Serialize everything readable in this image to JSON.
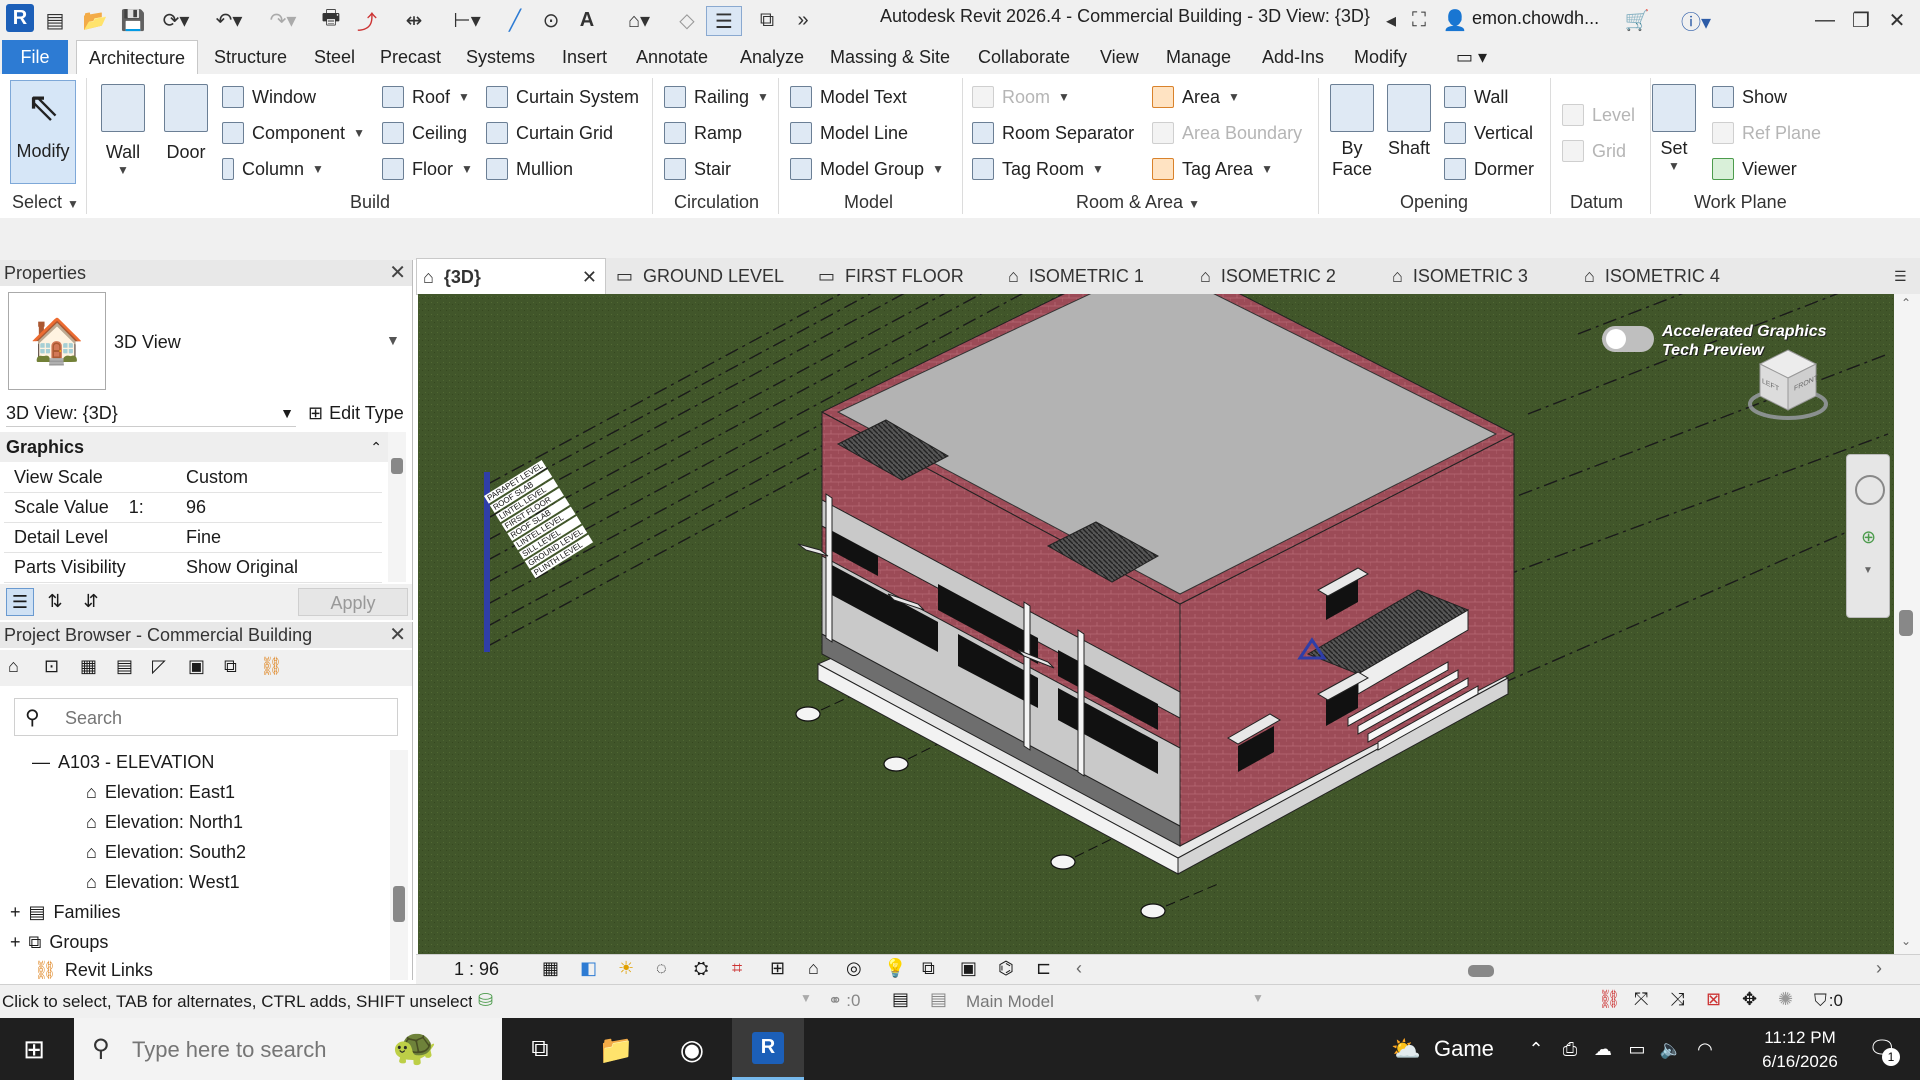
{
  "window": {
    "title": "Autodesk Revit 2026.4 - Commercial Building - 3D View: {3D}",
    "user": "emon.chowdh...",
    "logo_letter": "R"
  },
  "menu_tabs": [
    "File",
    "Architecture",
    "Structure",
    "Steel",
    "Precast",
    "Systems",
    "Insert",
    "Annotate",
    "Analyze",
    "Massing & Site",
    "Collaborate",
    "View",
    "Manage",
    "Add-Ins",
    "Modify"
  ],
  "ribbon": {
    "select": {
      "modify": "Modify",
      "panel": "Select"
    },
    "build": {
      "panel": "Build",
      "wall": "Wall",
      "door": "Door",
      "window": "Window",
      "component": "Component",
      "column": "Column",
      "roof": "Roof",
      "ceiling": "Ceiling",
      "floor": "Floor",
      "curtain_system": "Curtain  System",
      "curtain_grid": "Curtain  Grid",
      "mullion": "Mullion"
    },
    "circulation": {
      "panel": "Circulation",
      "railing": "Railing",
      "ramp": "Ramp",
      "stair": "Stair"
    },
    "model": {
      "panel": "Model",
      "model_text": "Model  Text",
      "model_line": "Model  Line",
      "model_group": "Model  Group"
    },
    "room_area": {
      "panel": "Room & Area",
      "room": "Room",
      "room_separator": "Room  Separator",
      "tag_room": "Tag  Room",
      "area": "Area",
      "area_boundary": "Area  Boundary",
      "tag_area": "Tag  Area"
    },
    "opening": {
      "panel": "Opening",
      "by_face_1": "By",
      "by_face_2": "Face",
      "shaft": "Shaft",
      "wall": "Wall",
      "vertical": "Vertical",
      "dormer": "Dormer"
    },
    "datum": {
      "panel": "Datum",
      "level": "Level",
      "grid": "Grid"
    },
    "work_plane": {
      "panel": "Work Plane",
      "set": "Set",
      "show": "Show",
      "ref_plane": "Ref  Plane",
      "viewer": "Viewer"
    }
  },
  "properties": {
    "title": "Properties",
    "type_name": "3D View",
    "instance": "3D View: {3D}",
    "edit_type": "Edit Type",
    "section": "Graphics",
    "rows": [
      {
        "key": "View Scale",
        "value": "Custom"
      },
      {
        "key": "Scale Value    1:",
        "value": "96"
      },
      {
        "key": "Detail Level",
        "value": "Fine"
      },
      {
        "key": "Parts Visibility",
        "value": "Show Original"
      }
    ],
    "apply": "Apply"
  },
  "browser": {
    "title": "Project Browser - Commercial Building",
    "search_placeholder": "Search",
    "group": "A103 - ELEVATION",
    "elevations": [
      "Elevation: East1",
      "Elevation: North1",
      "Elevation: South2",
      "Elevation: West1"
    ],
    "families": "Families",
    "groups": "Groups",
    "revit_links": "Revit Links"
  },
  "view_tabs": [
    "{3D}",
    "GROUND LEVEL",
    "FIRST FLOOR",
    "ISOMETRIC 1",
    "ISOMETRIC 2",
    "ISOMETRIC 3",
    "ISOMETRIC 4"
  ],
  "viewport": {
    "graphics_toggle_1": "Accelerated Graphics",
    "graphics_toggle_2": "Tech Preview",
    "level_labels": [
      "PARAPET LEVEL",
      "ROOF SLAB",
      "LINTEL LEVEL",
      "FIRST FLOOR",
      "ROOF SLAB",
      "LINTEL LEVEL",
      "SILL LEVEL",
      "GROUND LEVEL",
      "PLINTH LEVEL"
    ],
    "cube_left": "LEFT",
    "cube_front": "FRONT"
  },
  "view_control": {
    "scale": "1 : 96"
  },
  "status": {
    "hint": "Click to select, TAB for alternates, CTRL adds, SHIFT unselect",
    "zero": ":0",
    "model": "Main Model",
    "filter_count": ":0"
  },
  "taskbar": {
    "search_placeholder": "Type here to search",
    "game": "Game",
    "time": "11:12 PM",
    "date": "6/16/2026",
    "notifications": "1"
  },
  "colors": {
    "accent": "#2d7bd3",
    "grass": "#41562a",
    "brick": "#9c4b57",
    "roof": "#b3b3b3"
  }
}
